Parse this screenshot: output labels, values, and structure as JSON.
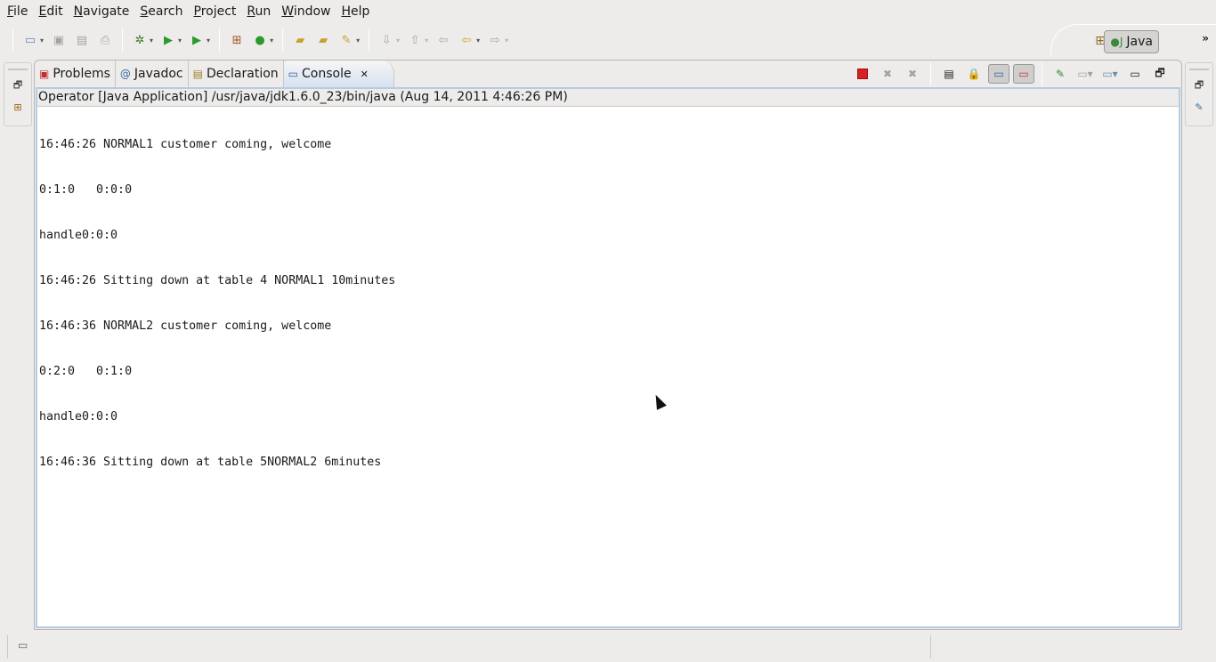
{
  "menu": [
    "File",
    "Edit",
    "Navigate",
    "Search",
    "Project",
    "Run",
    "Window",
    "Help"
  ],
  "perspective": {
    "label": "Java"
  },
  "tabs": [
    {
      "label": "Problems"
    },
    {
      "label": "Javadoc"
    },
    {
      "label": "Declaration"
    },
    {
      "label": "Console"
    }
  ],
  "console": {
    "process": "Operator [Java Application] /usr/java/jdk1.6.0_23/bin/java (Aug 14, 2011 4:46:26 PM)",
    "lines": [
      "16:46:26 NORMAL1 customer coming, welcome",
      "0:1:0   0:0:0",
      "handle0:0:0",
      "16:46:26 Sitting down at table 4 NORMAL1 10minutes",
      "16:46:36 NORMAL2 customer coming, welcome",
      "0:2:0   0:1:0",
      "handle0:0:0",
      "16:46:36 Sitting down at table 5NORMAL2 6minutes"
    ]
  },
  "colors": {
    "terminate": "#d92020",
    "accent": "#b6cbe4"
  }
}
